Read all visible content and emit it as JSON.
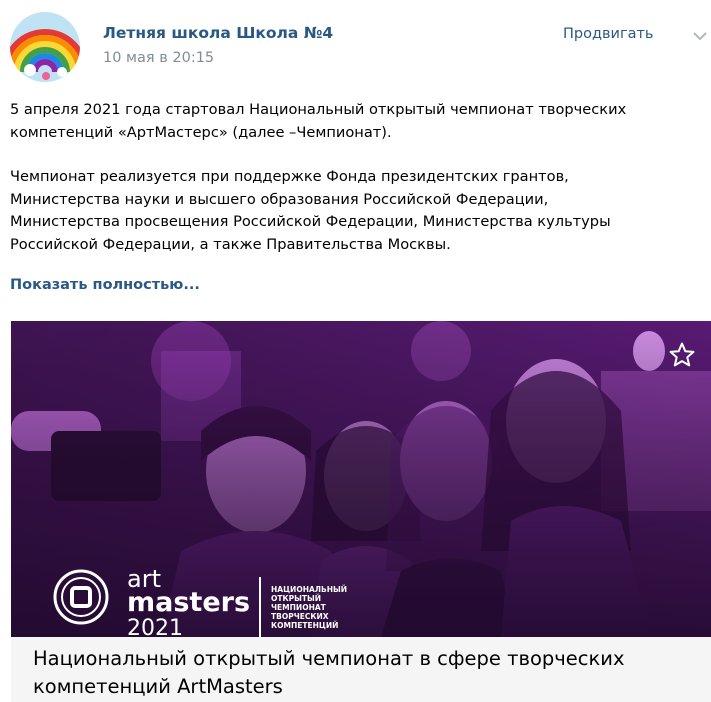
{
  "post": {
    "author": "Летняя школа Школа №4",
    "date": "10 мая в 20:15",
    "promote_label": "Продвигать",
    "text_lines": [
      "5 апреля 2021 года стартовал Национальный открытый чемпионат творческих",
      "компетенций «АртМастерс» (далее –Чемпионат).",
      "Чемпионат реализуется при поддержке Фонда президентских грантов,",
      "Министерства науки и высшего образования Российской Федерации,",
      "Министерства просвещения Российской Федерации, Министерства культуры",
      "Российской Федерации, а также Правительства Москвы."
    ],
    "show_more": "Показать полностью..."
  },
  "link_card": {
    "title_line1": "Национальный открытый чемпионат в сфере творческих",
    "title_line2": "компетенций ArtMasters",
    "brand_art": "art",
    "brand_masters": "masters",
    "brand_year": "2021",
    "tagline": [
      "НАЦИОНАЛЬНЫЙ",
      "ОТКРЫТЫЙ",
      "ЧЕМПИОНАТ",
      "ТВОРЧЕСКИХ",
      "КОМПЕТЕНЦИЙ"
    ]
  },
  "icons": {
    "avatar": "rainbow-avatar",
    "more": "chevron-down-icon",
    "bookmark": "star-icon",
    "brand": "artmasters-logo-icon"
  },
  "colors": {
    "link": "#2a5885",
    "secondary": "#818c99",
    "image_tint": "#9b2fb3",
    "caption_bg": "#f5f5f5"
  }
}
